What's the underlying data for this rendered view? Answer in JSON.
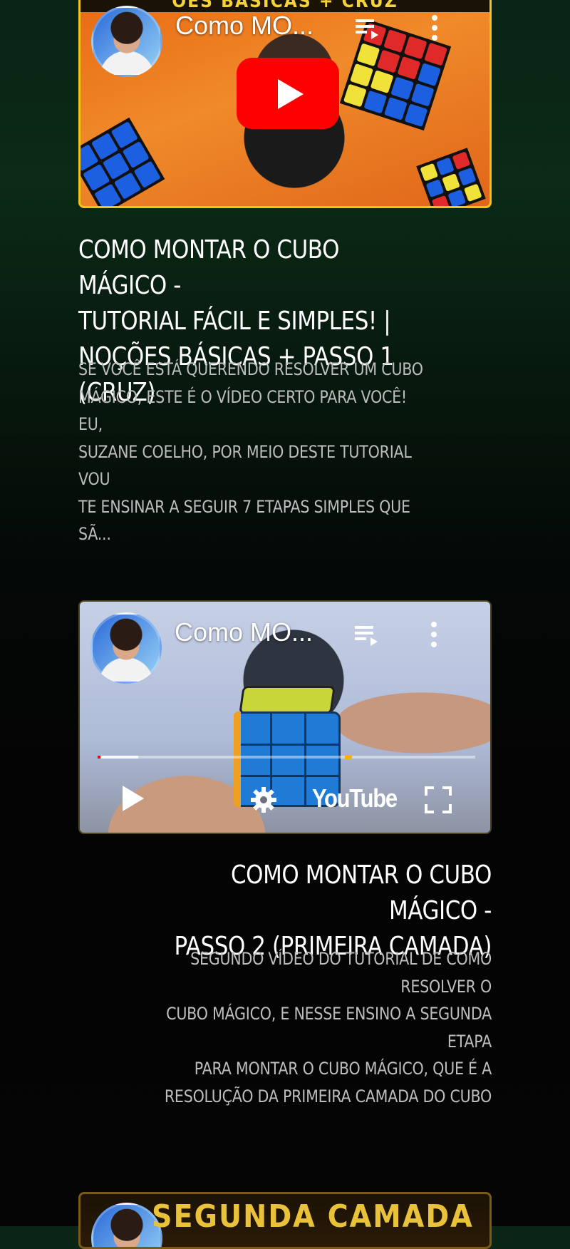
{
  "videos": [
    {
      "embed_title": "Como MO...",
      "banner": "OES BASICAS + CRUZ",
      "title_lines": [
        "Como montar o cubo mágico -",
        "Tutorial fácil e simples! |",
        "Noções básicas + Passo 1 (Cruz)"
      ],
      "description_lines": [
        "Se você está querendo resolver um cubo",
        "mágico, este é o vídeo certo para você! Eu,",
        "Suzane Coelho, por meio deste tutorial vou",
        "te ensinar a seguir 7 etapas simples que sã..."
      ],
      "align": "left"
    },
    {
      "embed_title": "Como MO...",
      "player_logo": "YouTube",
      "progress_fraction": 0.1,
      "title_lines": [
        "Como montar o cubo mágico -",
        "Passo 2 (primeira camada)"
      ],
      "description_lines": [
        "Segundo vídeo do tutorial de como resolver o",
        "cubo mágico, e nesse ensino a segunda etapa",
        "para montar o cubo mágico, que é a",
        "resolução da primeira camada do cubo"
      ],
      "align": "right"
    },
    {
      "banner": "SEGUNDA CAMADA"
    }
  ],
  "colors": {
    "accent_yellow": "#f0c419",
    "youtube_red": "#ff0000",
    "title_text": "#ffffff",
    "description_text": "#bdbdbd"
  },
  "icons": [
    "play-button-icon",
    "queue-icon",
    "more-vertical-icon",
    "settings-gear-icon",
    "fullscreen-icon"
  ]
}
